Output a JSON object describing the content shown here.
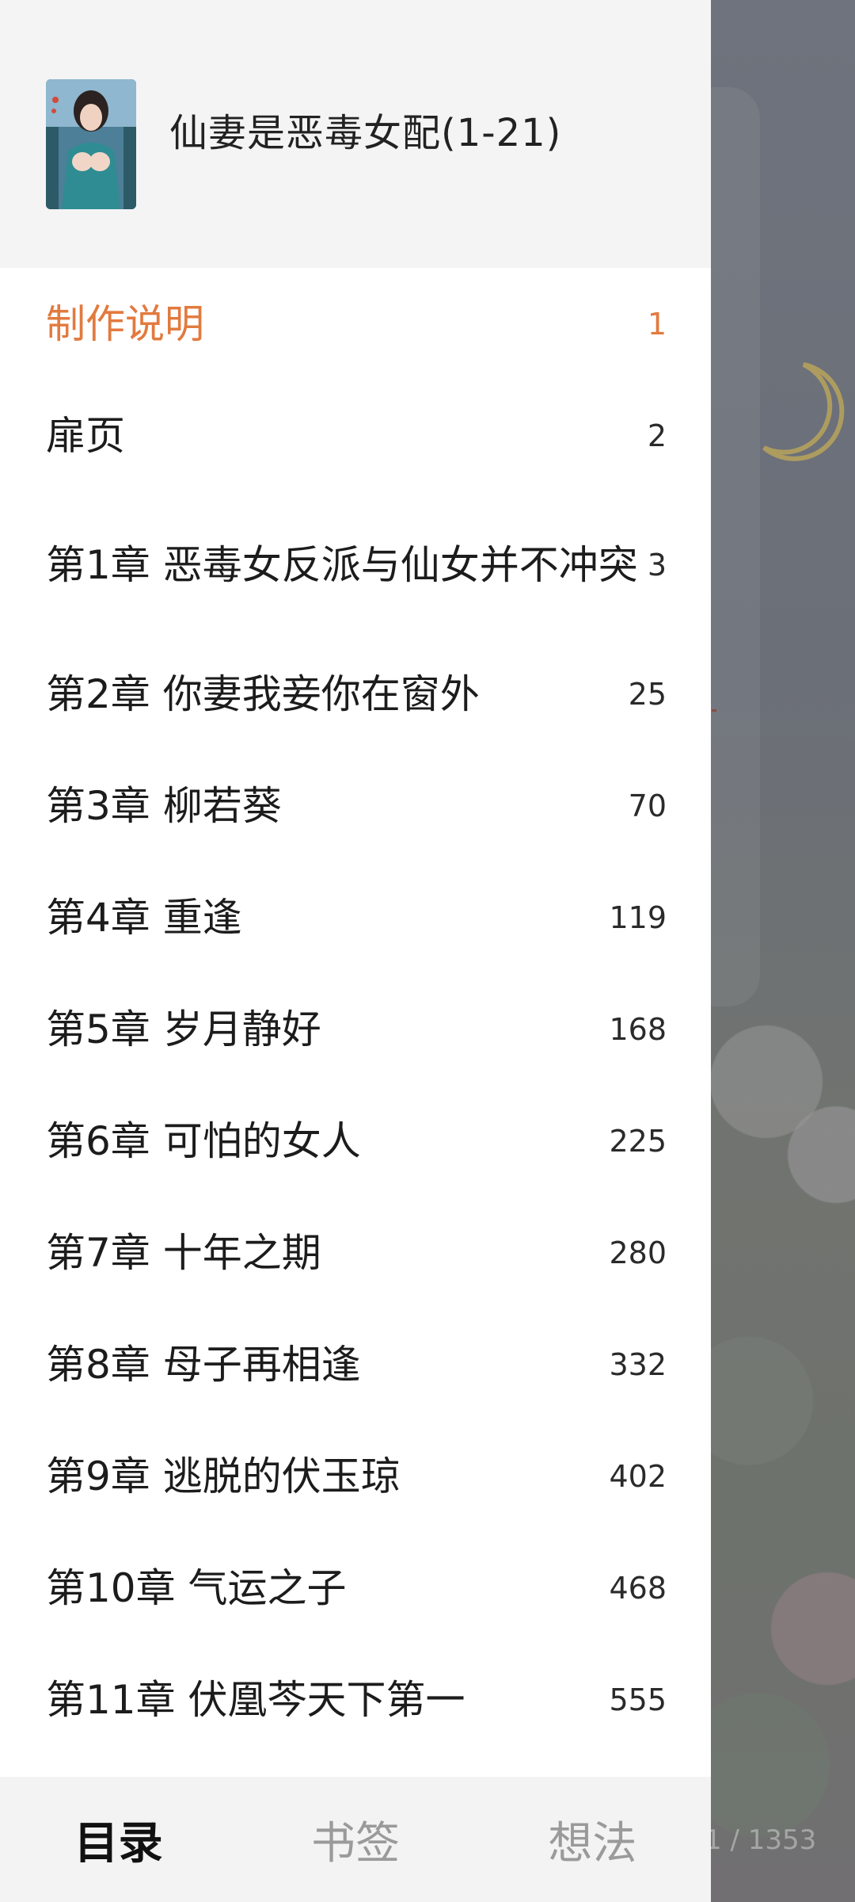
{
  "book": {
    "title": "仙妻是恶毒女配(1-21)"
  },
  "toc": [
    {
      "title": "制作说明",
      "page": "1",
      "active": true
    },
    {
      "title": "扉页",
      "page": "2"
    },
    {
      "title": "第1章 恶毒女反派与仙女并不冲突",
      "page": "3"
    },
    {
      "title": "第2章 你妻我妾你在窗外",
      "page": "25"
    },
    {
      "title": "第3章 柳若葵",
      "page": "70"
    },
    {
      "title": "第4章 重逢",
      "page": "119"
    },
    {
      "title": "第5章 岁月静好",
      "page": "168"
    },
    {
      "title": "第6章 可怕的女人",
      "page": "225"
    },
    {
      "title": "第7章 十年之期",
      "page": "280"
    },
    {
      "title": "第8章 母子再相逢",
      "page": "332"
    },
    {
      "title": "第9章 逃脱的伏玉琼",
      "page": "402"
    },
    {
      "title": "第10章 气运之子",
      "page": "468"
    },
    {
      "title": "第11章 伏凰芩天下第一",
      "page": "555"
    }
  ],
  "tabs": {
    "contents": "目录",
    "bookmarks": "书签",
    "notes": "想法"
  },
  "reader": {
    "page_indicator": "1 / 1353"
  },
  "colors": {
    "accent": "#e27a3f",
    "drawer_bg": "#ffffff",
    "header_bg": "#f4f4f4"
  }
}
